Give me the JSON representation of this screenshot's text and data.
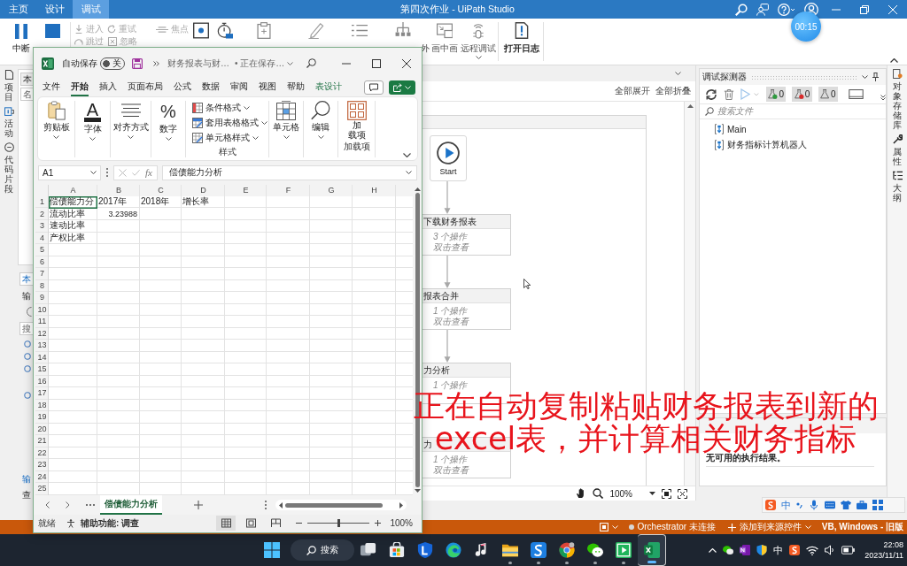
{
  "studio": {
    "tabs": [
      {
        "label": "主页",
        "selected": false
      },
      {
        "label": "设计",
        "selected": false
      },
      {
        "label": "调试",
        "selected": true
      }
    ],
    "title": "第四次作业 - UiPath Studio",
    "timer": "00:15"
  },
  "ribbon": {
    "pause": "中断",
    "row1": [
      "进入",
      "重试",
      "焦点"
    ],
    "row2": [
      "跳过",
      "忽略"
    ],
    "fragment": "外",
    "tools": [
      {
        "label": "画中画",
        "caret": false
      },
      {
        "label": "远程调试",
        "caret": true
      }
    ],
    "open_log": "打开日志"
  },
  "left_strip": [
    "项目",
    "活动",
    "代码片段"
  ],
  "left_panel": {
    "top_tab": {
      "label": "本",
      "selected": false
    },
    "top_field": "名",
    "bottom_tab": {
      "label": "本",
      "selected": true
    },
    "section": "输",
    "search": "搜",
    "footer_tabs": [
      {
        "label": "输",
        "selected": true
      },
      {
        "label": "查",
        "selected": false
      }
    ]
  },
  "designer": {
    "expand_all": "全部展开",
    "collapse_all": "全部折叠",
    "start": "Start",
    "activities": [
      {
        "title": "下载财务报表",
        "count": "3 个操作",
        "hint": "双击查看"
      },
      {
        "title": "报表合并",
        "count": "1 个操作",
        "hint": "双击查看"
      },
      {
        "title": "力分析",
        "count": "1 个操作"
      },
      {
        "title": "力",
        "count": "1 个操作",
        "hint": "双击查看"
      }
    ],
    "zoom": "100%"
  },
  "debug_explorer": {
    "title": "调试探测器",
    "counters": [
      {
        "kind": "passed",
        "count": "0"
      },
      {
        "kind": "failed",
        "count": "0"
      },
      {
        "kind": "other",
        "count": "0"
      }
    ],
    "search": {
      "placeholder": "搜索文件"
    },
    "files": [
      "Main",
      "财务指标计算机器人"
    ]
  },
  "results": {
    "message": "无可用的执行结果。"
  },
  "right_strip": [
    "对象存储库",
    "属性",
    "大纲"
  ],
  "status_bar": {
    "orchestrator": "Orchestrator 未连接",
    "source_control": "添加到来源控件",
    "profile": "VB, Windows - 旧版"
  },
  "excel": {
    "autosave_label": "自动保存",
    "autosave": {
      "on": false,
      "label": "关"
    },
    "file_name": "财务报表与财…",
    "save_status": "• 正在保存…",
    "menu": [
      {
        "label": "文件",
        "kind": "tab",
        "selected": false
      },
      {
        "label": "开始",
        "kind": "tab",
        "selected": true
      },
      {
        "label": "插入",
        "kind": "tab",
        "selected": false
      },
      {
        "label": "页面布局",
        "kind": "tab",
        "selected": false
      },
      {
        "label": "公式",
        "kind": "tab",
        "selected": false
      },
      {
        "label": "数据",
        "kind": "tab",
        "selected": false
      },
      {
        "label": "审阅",
        "kind": "tab",
        "selected": false
      },
      {
        "label": "视图",
        "kind": "tab",
        "selected": false
      },
      {
        "label": "帮助",
        "kind": "tab",
        "selected": false
      },
      {
        "label": "表设计",
        "kind": "contextual",
        "selected": false
      }
    ],
    "ribbon": {
      "clipboard": "剪贴板",
      "font_glyph": "A",
      "font": "字体",
      "align": "对齐方式",
      "number_glyph": "%",
      "number": "数字",
      "styles": [
        "条件格式",
        "套用表格格式",
        "单元格样式"
      ],
      "styles_label": "样式",
      "cells": "单元格",
      "editing": "编辑",
      "addins_lines": [
        "加",
        "载项"
      ],
      "addins_label": "加载项"
    },
    "name_box": "A1",
    "function_label": "fx",
    "formula": "偿债能力分析",
    "columns": [
      "A",
      "B",
      "C",
      "D",
      "E",
      "F",
      "G",
      "H"
    ],
    "row_numbers": [
      "1",
      "2",
      "3",
      "4",
      "5",
      "6",
      "7",
      "8",
      "9",
      "10",
      "11",
      "12",
      "13",
      "14",
      "15",
      "16",
      "17",
      "18",
      "19",
      "20",
      "21",
      "22",
      "23",
      "24",
      "25"
    ],
    "cells": [
      [
        {
          "text": "偿债能力分",
          "kind": "text",
          "selected": true
        },
        {
          "text": "2017年",
          "kind": "text",
          "selected": false
        },
        {
          "text": "2018年",
          "kind": "text",
          "selected": false
        },
        {
          "text": "增长率",
          "kind": "text",
          "selected": false
        }
      ],
      [
        {
          "text": "流动比率",
          "kind": "text",
          "selected": false
        },
        {
          "text": "3.23988",
          "kind": "number",
          "selected": false
        }
      ],
      [
        {
          "text": "速动比率",
          "kind": "text",
          "selected": false
        }
      ],
      [
        {
          "text": "产权比率",
          "kind": "text",
          "selected": false
        }
      ]
    ],
    "sheets": [
      {
        "label": "偿债能力分析",
        "selected": true
      }
    ],
    "status": "就绪",
    "accessibility": "辅助功能: 调查",
    "views": [
      {
        "kind": "normal",
        "selected": true
      },
      {
        "kind": "page_layout",
        "selected": false
      },
      {
        "kind": "page_break",
        "selected": false
      }
    ],
    "zoom": {
      "level": 0.5,
      "reading": "100%"
    }
  },
  "caption": {
    "lines": [
      "正在自动复制粘贴财务报表到新的",
      "excel表，并计算相关财务指标"
    ]
  },
  "ime": {
    "mode": "中"
  },
  "taskbar": {
    "search": "搜索",
    "apps": [
      {
        "kind": "taskview",
        "running": false,
        "selected": false
      },
      {
        "kind": "store",
        "running": false,
        "selected": false
      },
      {
        "kind": "shield",
        "running": false,
        "selected": false
      },
      {
        "kind": "edge",
        "running": false,
        "selected": false
      },
      {
        "kind": "music",
        "running": false,
        "selected": false
      },
      {
        "kind": "folder",
        "running": true,
        "selected": false
      },
      {
        "kind": "swirl",
        "running": true,
        "selected": false
      },
      {
        "kind": "chrome",
        "running": true,
        "selected": false
      },
      {
        "kind": "wechat",
        "running": true,
        "selected": false
      },
      {
        "kind": "player",
        "running": true,
        "selected": false
      },
      {
        "kind": "excel",
        "running": true,
        "selected": true
      }
    ],
    "tray_ime": "中",
    "time": "22:08",
    "date": "2023/11/11"
  }
}
